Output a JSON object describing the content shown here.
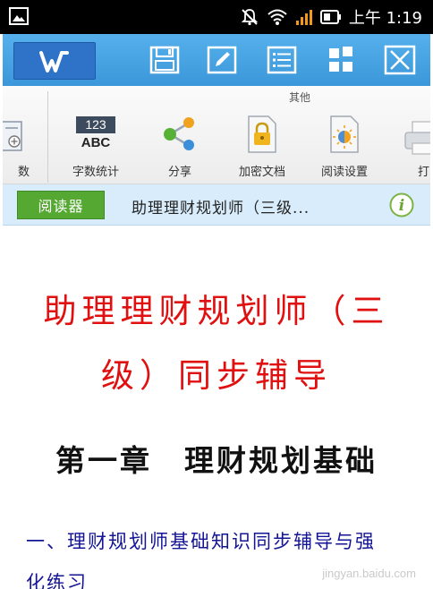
{
  "status_bar": {
    "time": "上午 1:19",
    "icons": [
      "gallery-icon",
      "mute-bell-icon",
      "wifi-icon",
      "signal-icon",
      "battery-icon"
    ]
  },
  "toolbar": {
    "logo": "W",
    "buttons": [
      "save-icon",
      "edit-icon",
      "list-icon",
      "grid-icon",
      "close-icon"
    ],
    "accent": "#3b97d9"
  },
  "ribbon": {
    "group_label": "其他",
    "items": [
      {
        "label": "数",
        "icon": "page-plus-icon"
      },
      {
        "label": "字数统计",
        "icon": "word-count-icon",
        "icon_text_top": "123",
        "icon_text_bottom": "ABC"
      },
      {
        "label": "分享",
        "icon": "share-icon"
      },
      {
        "label": "加密文档",
        "icon": "lock-icon"
      },
      {
        "label": "阅读设置",
        "icon": "reading-settings-icon"
      },
      {
        "label": "打印",
        "icon": "print-icon"
      }
    ]
  },
  "reader_bar": {
    "reader_button": "阅读器",
    "title": "助理理财规划师（三级...",
    "info_glyph": "i"
  },
  "document": {
    "heading_line1": "助理理财规划师（三",
    "heading_line2": "级）同步辅导",
    "chapter": "第一章　理财规划基础",
    "section_line1": "一、理财规划师基础知识同步辅导与强",
    "section_line2": "化练习",
    "heading_color": "#e01010",
    "section_color": "#141496"
  },
  "watermark": "jingyan.baidu.com"
}
